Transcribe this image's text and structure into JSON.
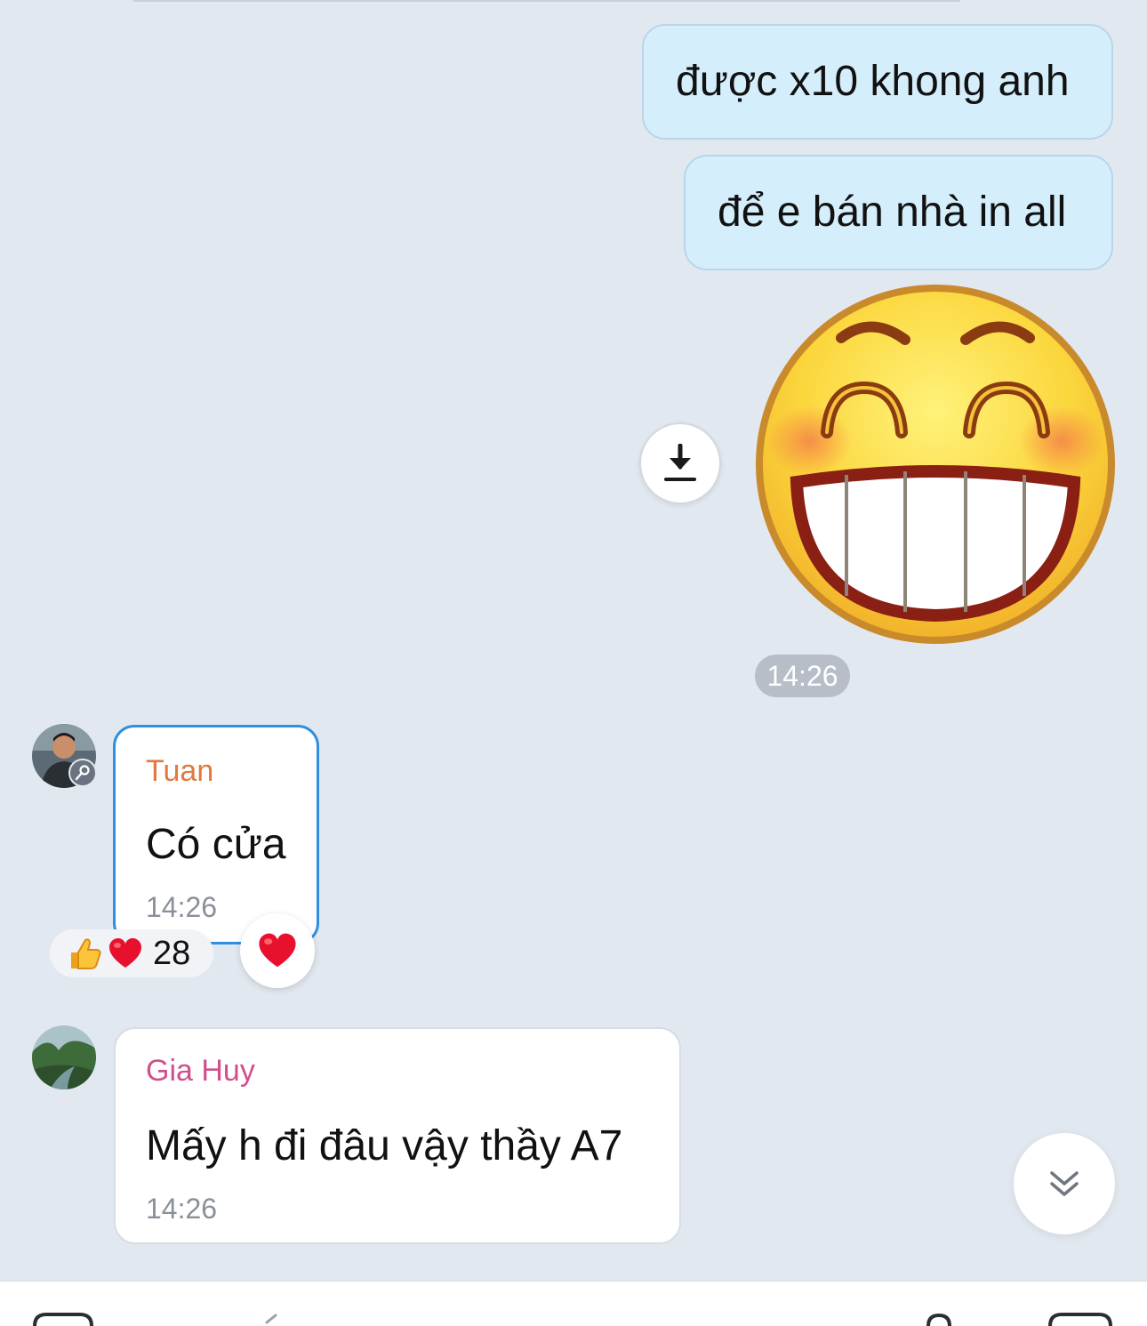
{
  "outgoing": [
    {
      "text": "được x10 khong anh"
    },
    {
      "text": "để e bán nhà in all"
    }
  ],
  "sticker": {
    "name": "grinning-face-sticker"
  },
  "sticker_time": "14:26",
  "incoming": [
    {
      "sender": "Tuan",
      "text": "Có cửa",
      "time": "14:26",
      "sender_color": "#e07a3f"
    },
    {
      "sender": "Gia Huy",
      "text": "Mấy h đi đâu vậy thầy A7",
      "time": "14:26",
      "sender_color": "#d14f8c"
    }
  ],
  "reactions": {
    "icons": [
      "thumbs-up",
      "heart"
    ],
    "count": "28"
  },
  "colors": {
    "outgoing_bubble": "#d5eefb",
    "selected_border": "#2f8fe0",
    "background": "#e2e8f0"
  }
}
